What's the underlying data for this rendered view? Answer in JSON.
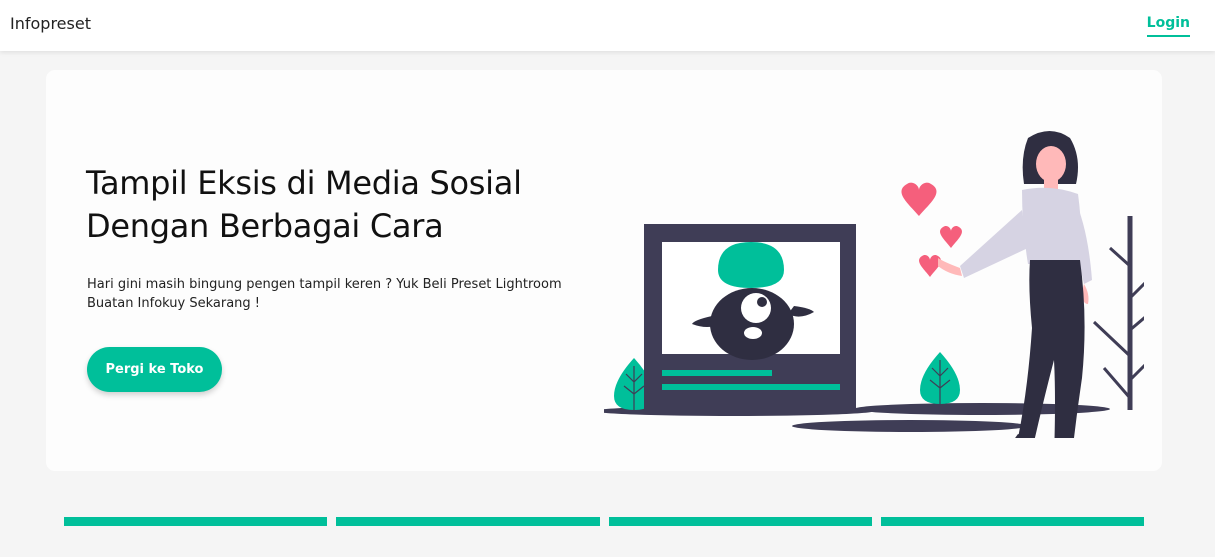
{
  "navbar": {
    "brand": "Infopreset",
    "login_label": "Login"
  },
  "hero": {
    "title": "Tampil Eksis di Media Sosial Dengan Berbagai Cara",
    "description": "Hari gini masih bingung pengen tampil keren ? Yuk Beli Preset Lightroom Buatan Infokuy Sekarang !",
    "cta_label": "Pergi ke Toko"
  },
  "colors": {
    "accent": "#00bf9a",
    "heart": "#f55f7c",
    "dark": "#3f3d56",
    "sweater": "#d6d3e3"
  }
}
